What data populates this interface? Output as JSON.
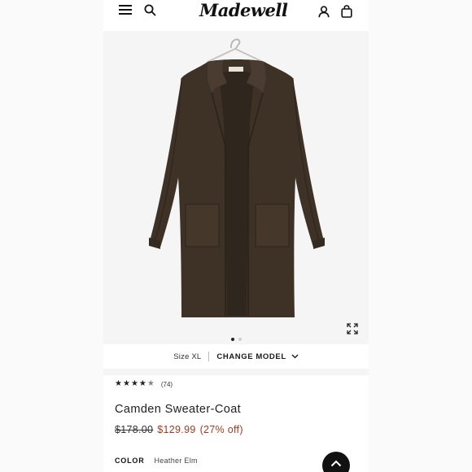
{
  "header": {
    "logo_text": "Madewell",
    "icons": [
      "menu-icon",
      "search-icon",
      "account-icon",
      "bag-icon"
    ]
  },
  "gallery": {
    "image_count": 2,
    "active_index": 0,
    "icons": [
      "expand-icon"
    ]
  },
  "size_bar": {
    "size_label": "Size XL",
    "change_model_label": "CHANGE MODEL"
  },
  "product": {
    "rating": 4.5,
    "review_count": "(74)",
    "title": "Camden Sweater-Coat",
    "original_price": "$178.00",
    "sale_price": "$129.99",
    "discount": "(27% off)",
    "color_label": "COLOR",
    "color_value": "Heather Elm"
  },
  "colors": {
    "sale": "#a23b21",
    "coat": "#3e3227",
    "background": "#f6f5f6"
  }
}
